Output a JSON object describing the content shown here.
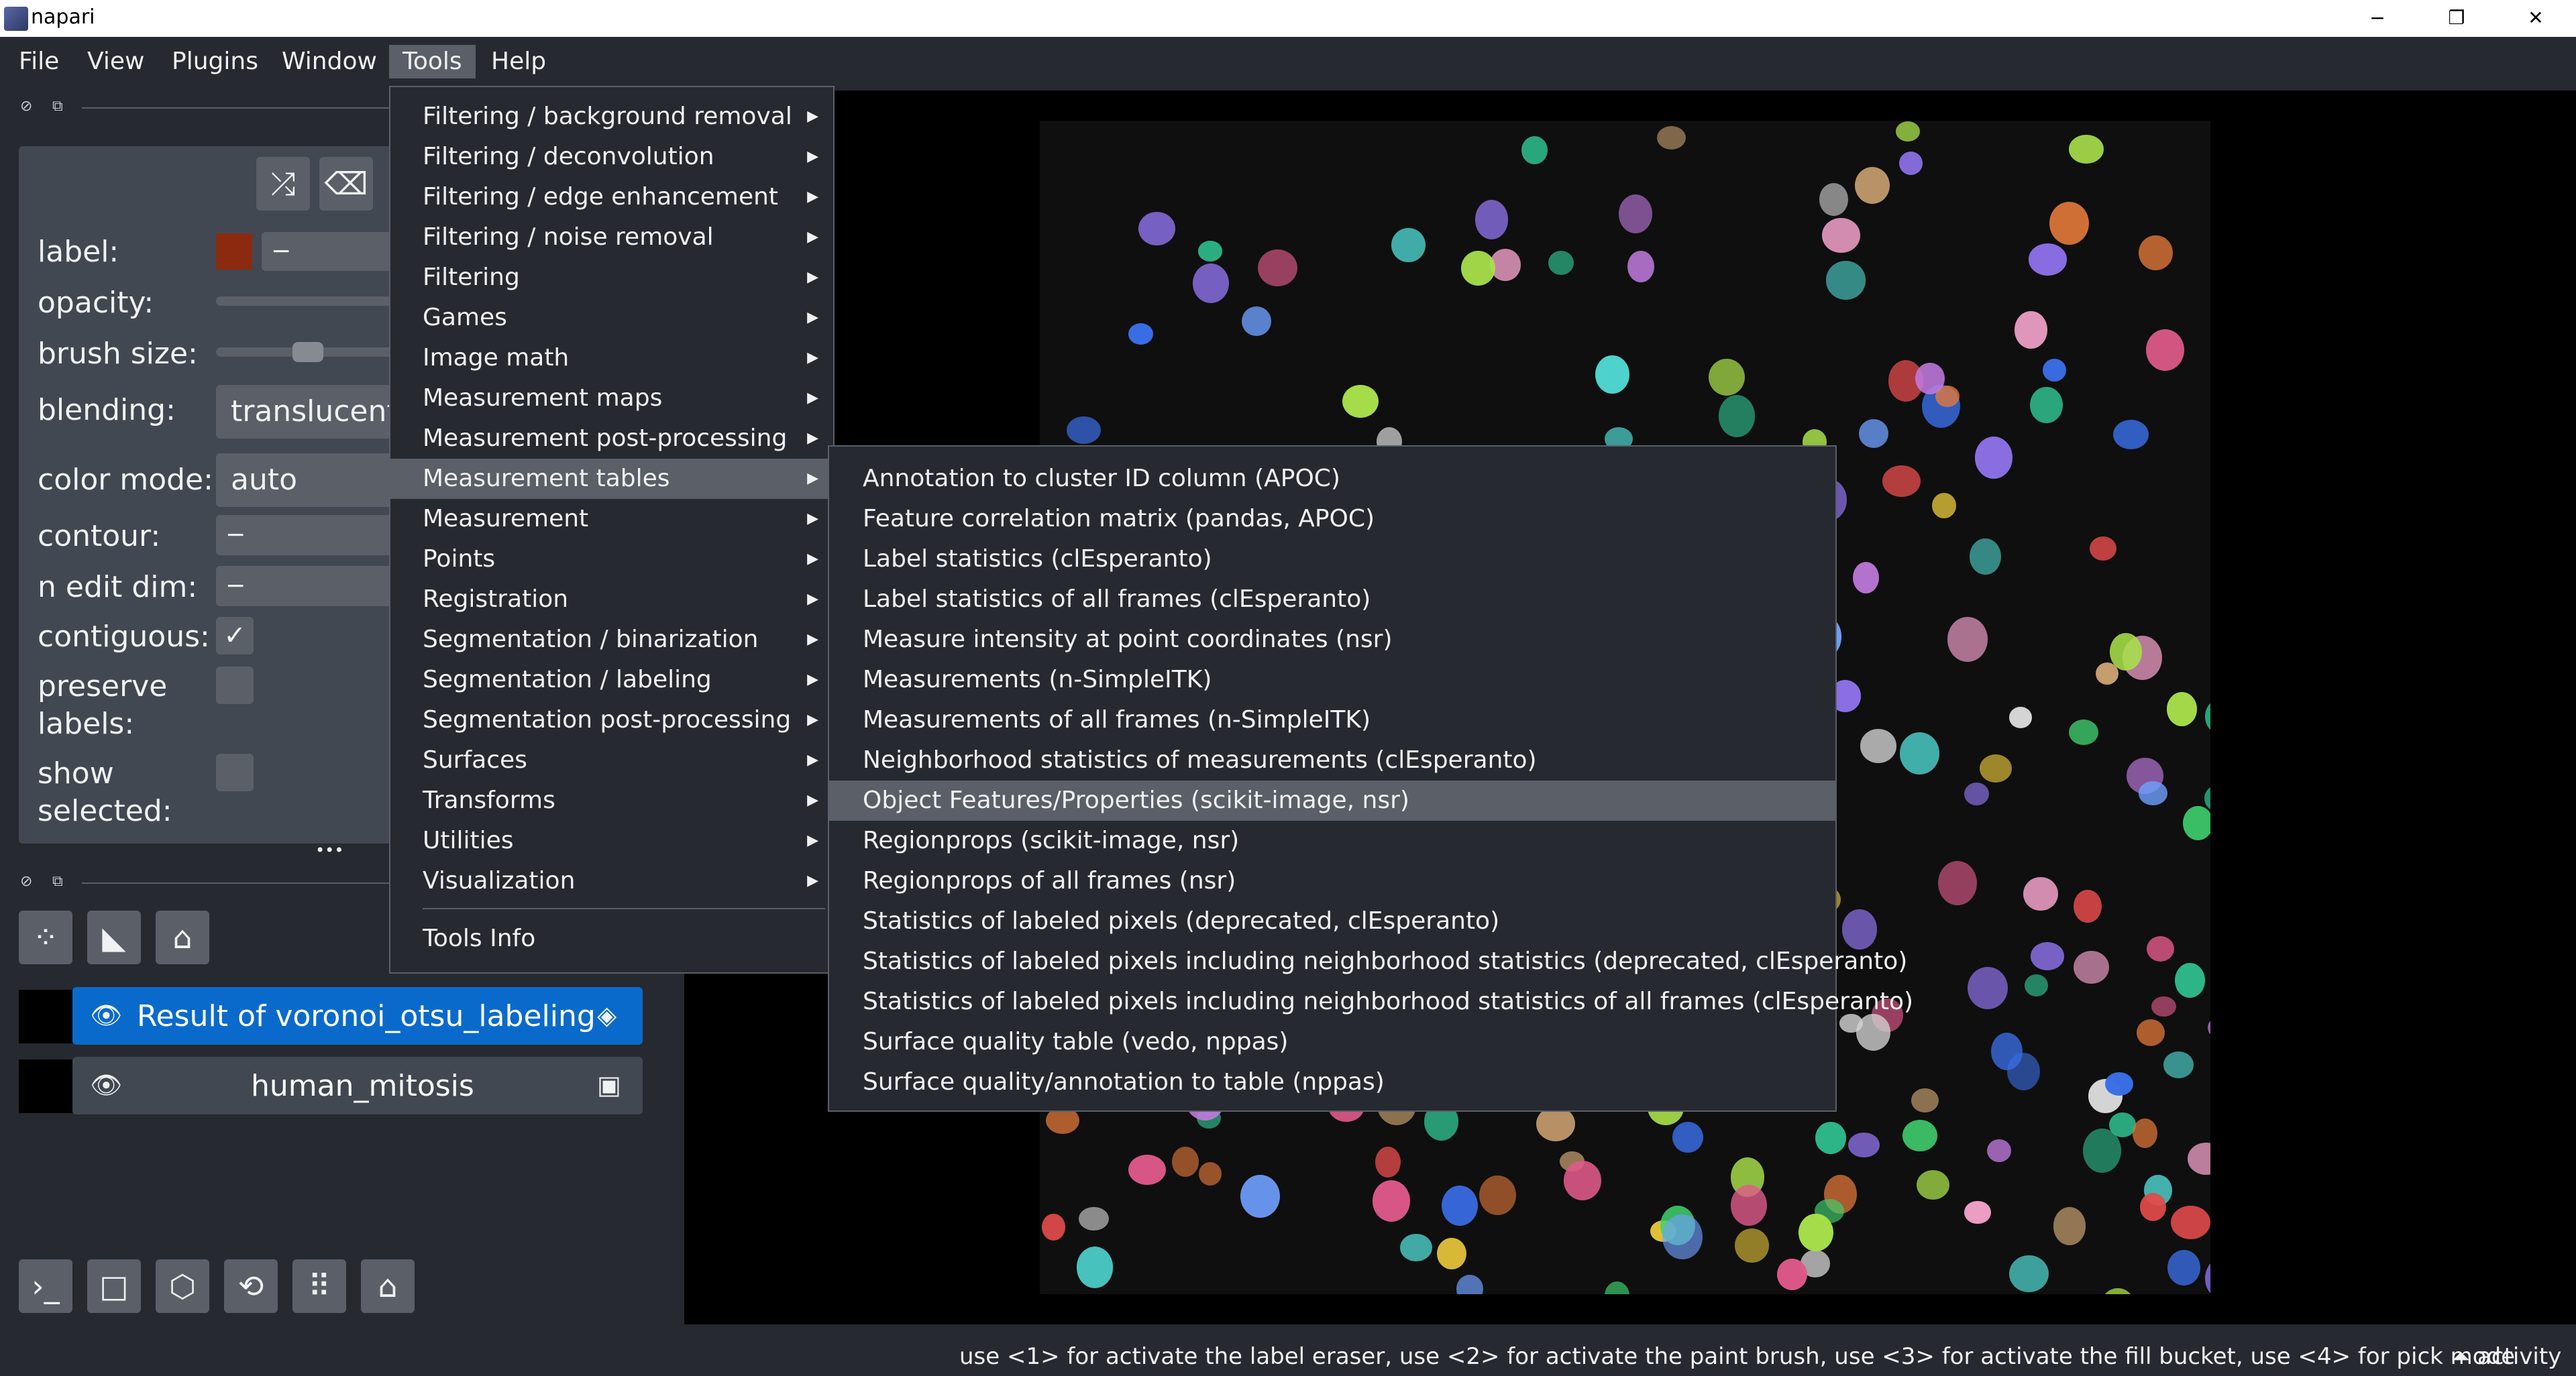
{
  "window": {
    "title": "napari",
    "minimize": "−",
    "restore": "❐",
    "close": "✕"
  },
  "menubar": [
    "File",
    "View",
    "Plugins",
    "Window",
    "Tools",
    "Help"
  ],
  "layer_controls": {
    "label": "label:",
    "label_value": "−",
    "opacity": "opacity:",
    "brush_size": "brush size:",
    "blending": "blending:",
    "blending_value": "translucent",
    "color_mode": "color mode:",
    "color_mode_value": "auto",
    "contour": "contour:",
    "contour_value": "−",
    "n_edit_dim": "n edit dim:",
    "n_edit_dim_value": "−",
    "contiguous": "contiguous:",
    "preserve": "preserve",
    "labels": "labels:",
    "show": "show",
    "selected": "selected:",
    "more": "•••"
  },
  "layers": [
    {
      "name": "Result of voronoi_otsu_labeling",
      "selected": true
    },
    {
      "name": "human_mitosis",
      "selected": false
    }
  ],
  "tools_menu": [
    "Filtering / background removal",
    "Filtering / deconvolution",
    "Filtering / edge enhancement",
    "Filtering / noise removal",
    "Filtering",
    "Games",
    "Image math",
    "Measurement maps",
    "Measurement post-processing",
    "Measurement tables",
    "Measurement",
    "Points",
    "Registration",
    "Segmentation / binarization",
    "Segmentation / labeling",
    "Segmentation post-processing",
    "Surfaces",
    "Transforms",
    "Utilities",
    "Visualization"
  ],
  "tools_info": "Tools Info",
  "submenu": [
    "Annotation to cluster ID column (APOC)",
    "Feature correlation matrix (pandas, APOC)",
    "Label statistics (clEsperanto)",
    "Label statistics of all frames (clEsperanto)",
    "Measure intensity at point coordinates (nsr)",
    "Measurements (n-SimpleITK)",
    "Measurements of all frames (n-SimpleITK)",
    "Neighborhood statistics of measurements (clEsperanto)",
    "Object Features/Properties (scikit-image, nsr)",
    "Regionprops (scikit-image, nsr)",
    "Regionprops of all frames (nsr)",
    "Statistics of labeled pixels (deprecated, clEsperanto)",
    "Statistics of labeled pixels including neighborhood statistics (deprecated, clEsperanto)",
    "Statistics of labeled pixels including neighborhood statistics of all frames (clEsperanto)",
    "Surface quality table (vedo, nppas)",
    "Surface quality/annotation to table (nppas)"
  ],
  "status": {
    "text": "use <1> for activate the label eraser, use <2> for activate the paint brush, use <3> for activate the fill bucket, use <4> for pick mode",
    "activity": "⏶ activity"
  },
  "colors": {
    "background": "#262930",
    "panel": "#414851",
    "highlight": "#5a5f68",
    "selected_layer": "#0a6acb",
    "label_swatch": "#8c2a0f"
  }
}
